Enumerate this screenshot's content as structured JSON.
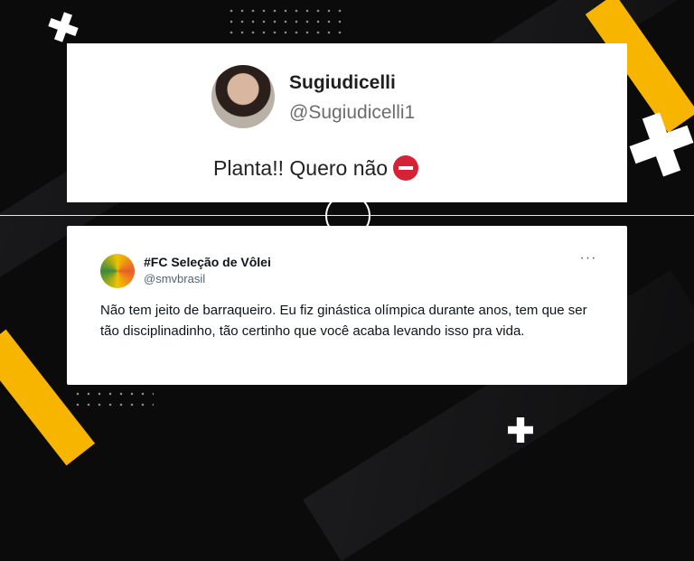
{
  "tweet_top": {
    "name": "Sugiudicelli",
    "handle": "@Sugiudicelli1",
    "text": "Planta!! Quero não"
  },
  "tweet_bottom": {
    "name": "#FC Seleção de Vôlei",
    "handle": "@smvbrasil",
    "more_label": "···",
    "text": "Não tem jeito de barraqueiro. Eu fiz ginástica olímpica durante anos, tem que ser tão disciplinadinho, tão certinho que você acaba levando isso pra vida."
  },
  "colors": {
    "accent_yellow": "#f7b500",
    "background": "#0b0b0c"
  },
  "icons": [
    "plus-icon",
    "no-entry-icon",
    "more-options-icon"
  ]
}
